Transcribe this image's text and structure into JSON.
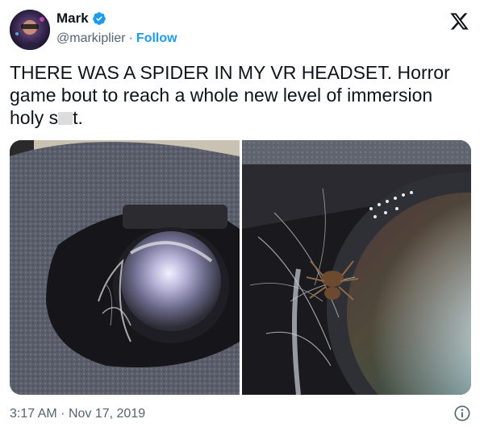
{
  "author": {
    "display_name": "Mark",
    "handle": "@markiplier",
    "separator": "·",
    "follow_label": "Follow",
    "verified": true
  },
  "tweet": {
    "text_part1": "THERE WAS A SPIDER IN MY VR HEADSET. Horror game bout to reach a whole new level of immersion holy s",
    "text_part2": "t."
  },
  "media": {
    "photos": [
      {
        "subject": "vr-headset-lens-wide"
      },
      {
        "subject": "vr-headset-lens-spider-closeup"
      }
    ]
  },
  "footer": {
    "time": "3:17 AM",
    "separator": "·",
    "date": "Nov 17, 2019"
  },
  "icons": {
    "verified": "verified-badge-icon",
    "brand": "x-logo-icon",
    "info": "info-icon"
  },
  "colors": {
    "accent": "#1d9bf0",
    "text": "#0f1419",
    "muted": "#536471"
  }
}
